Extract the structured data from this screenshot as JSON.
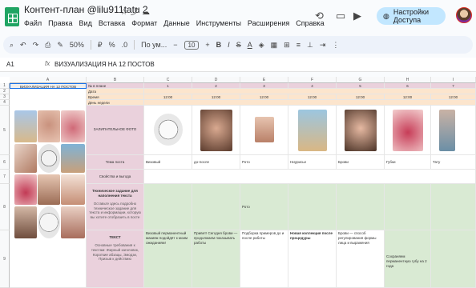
{
  "header": {
    "title": "Контент-план @lilu911tatu 2",
    "menu": [
      "Файл",
      "Правка",
      "Вид",
      "Вставка",
      "Формат",
      "Данные",
      "Инструменты",
      "Расширения",
      "Справка"
    ],
    "share_label": "Настройки Доступа"
  },
  "toolbar": {
    "zoom": "50%",
    "font": "По ум...",
    "font_size": "10"
  },
  "formula_bar": {
    "cell_ref": "A1",
    "fx": "fx",
    "value": "ВИЗУАЛИЗАЦИЯ НА 12 ПОСТОВ"
  },
  "sheet": {
    "col_letters": [
      "A",
      "B",
      "C",
      "D",
      "E",
      "F",
      "G",
      "H",
      "I"
    ],
    "row_numbers": [
      "1",
      "2",
      "3",
      "4",
      "5",
      "6",
      "7",
      "8",
      "9"
    ],
    "a1": "ВИЗУАЛИЗАЦИЯ НА 12 ПОСТОВ",
    "labels": {
      "post_no": "№ в плане",
      "date": "Дата",
      "time": "Время",
      "weekday": "День недели",
      "photo": "ЗАЛИПАТЕЛЬНОЕ ФОТО",
      "topic": "Тема поста",
      "cta": "Свойства и выгода",
      "tech": "Техническое задание для наполнения текста",
      "tech_desc": "Оставьте здесь подробно техническое задание для текста и информации, которую вы хотите отобразить в посте",
      "text": "ТЕКСТ",
      "text_desc": "Основные требования к текстам: Жирный заголовок, Короткие абзацы, Эмодзи, Призыв к действию"
    },
    "post_numbers": [
      "1",
      "2",
      "3",
      "4",
      "5",
      "6",
      "7"
    ],
    "times": [
      "12:00",
      "12:00",
      "12:00",
      "12:00",
      "12:00",
      "12:00",
      "12:00"
    ],
    "topics": [
      "Визовый",
      "до-после",
      "Рото",
      "Ниурисье",
      "Брови",
      "Губки",
      "Тату"
    ],
    "texts": [
      "Визовый перманентный макияж подойдёт к моим ожиданиям!",
      "Привет! Сегодня брови — продолжаем показывать работы",
      "Подборка примеров до и после работы",
      "Новая коллекция после процедуры",
      "Брови — способ регулирования формы лица и выражения",
      "Основные правила по уходу после процедуры",
      "Сохраняем перманентную губу на 2 года"
    ],
    "col6_text": "Рото"
  },
  "colors": {
    "pink": "#ead1dc",
    "peach": "#fce5cd",
    "green": "#d9ead3",
    "share_bg": "#c2e7ff"
  }
}
